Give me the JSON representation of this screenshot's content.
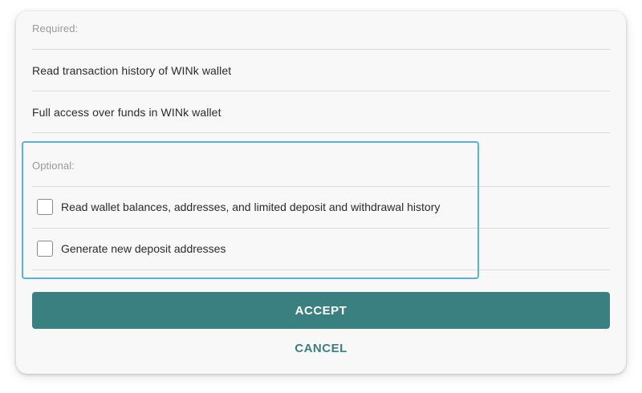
{
  "required": {
    "label": "Required:",
    "items": [
      "Read transaction history of WINk wallet",
      "Full access over funds in WINk wallet"
    ]
  },
  "optional": {
    "label": "Optional:",
    "items": [
      {
        "label": "Read wallet balances, addresses, and limited deposit and withdrawal history",
        "checked": false
      },
      {
        "label": "Generate new deposit addresses",
        "checked": false
      }
    ]
  },
  "actions": {
    "accept_label": "ACCEPT",
    "cancel_label": "CANCEL"
  },
  "colors": {
    "accent": "#3a8080",
    "highlight": "#5ab0da"
  }
}
